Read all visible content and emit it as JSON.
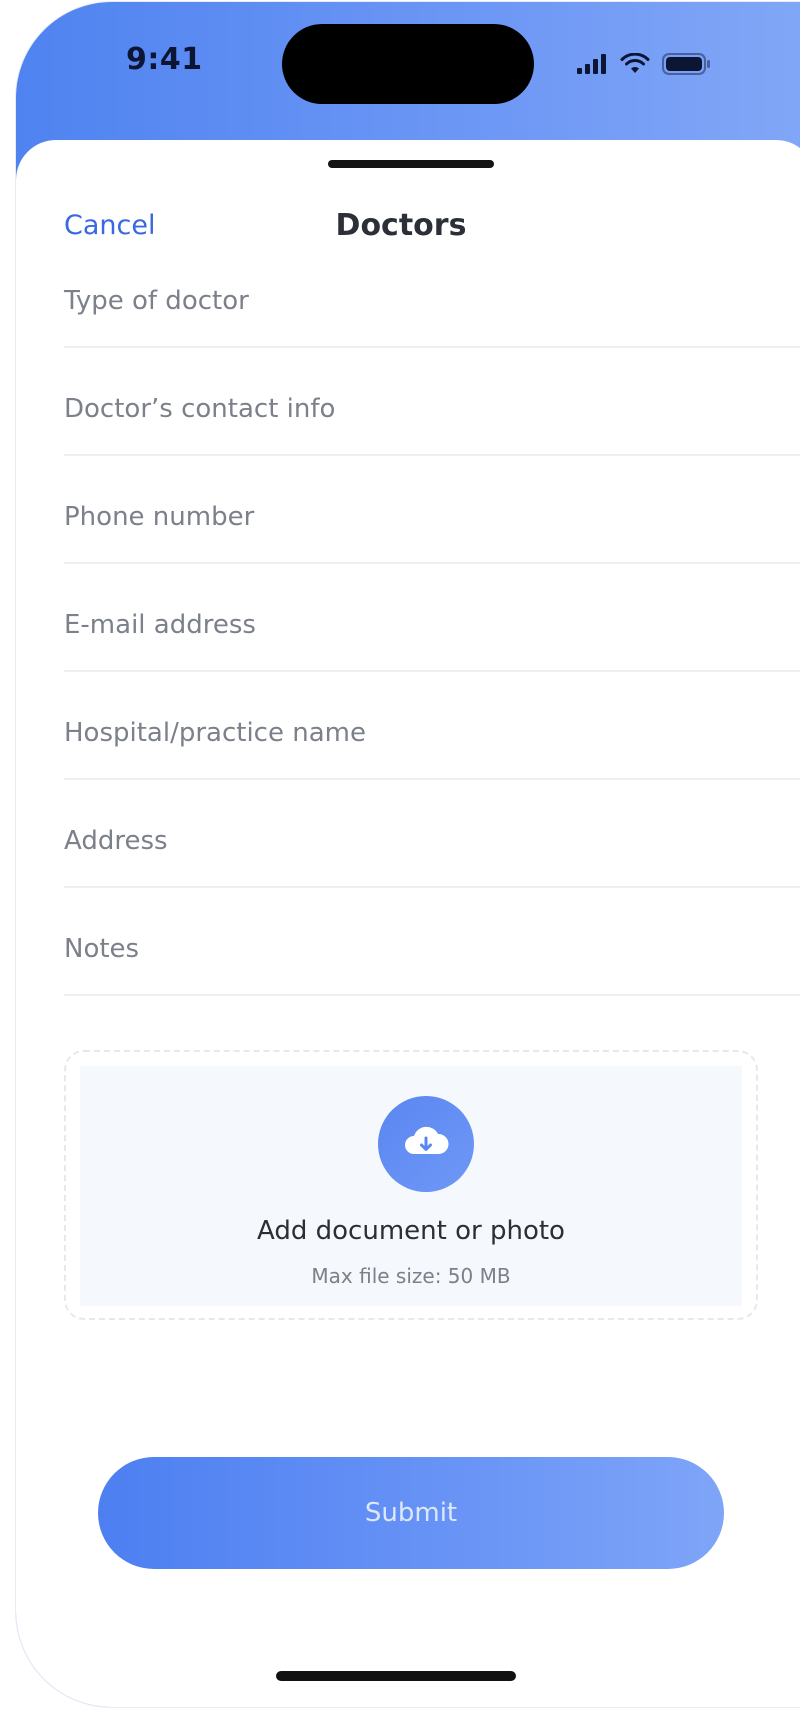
{
  "status_bar": {
    "time": "9:41"
  },
  "header": {
    "cancel_label": "Cancel",
    "title": "Doctors"
  },
  "form": {
    "fields": [
      {
        "placeholder": "Type of doctor"
      },
      {
        "placeholder": "Doctor’s contact info"
      },
      {
        "placeholder": "Phone number"
      },
      {
        "placeholder": "E-mail address"
      },
      {
        "placeholder": "Hospital/practice name"
      },
      {
        "placeholder": "Address"
      },
      {
        "placeholder": "Notes"
      }
    ]
  },
  "upload": {
    "icon": "cloud-download-icon",
    "label": "Add document or photo",
    "max_size": "Max file size: 50 MB"
  },
  "submit_label": "Submit",
  "colors": {
    "accent": "#4f83f0",
    "cancel_text": "#3a68e0",
    "field_text": "#7b808a"
  }
}
